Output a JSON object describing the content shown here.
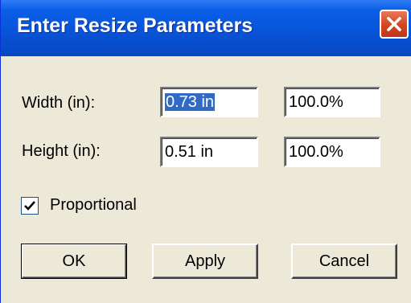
{
  "window": {
    "title": "Enter Resize Parameters"
  },
  "width": {
    "label": "Width (in):",
    "value": "0.73 in",
    "percent": "100.0%"
  },
  "height": {
    "label": "Height (in):",
    "value": "0.51 in",
    "percent": "100.0%"
  },
  "proportional": {
    "label": "Proportional",
    "checked": true
  },
  "buttons": {
    "ok": "OK",
    "apply": "Apply",
    "cancel": "Cancel"
  },
  "colors": {
    "titlebar": "#0854d9",
    "dialog_bg": "#ece9d8",
    "selection": "#316ac5",
    "close_button": "#d2451f"
  },
  "icons": {
    "close": "close-icon",
    "checkmark": "checkmark-icon"
  }
}
